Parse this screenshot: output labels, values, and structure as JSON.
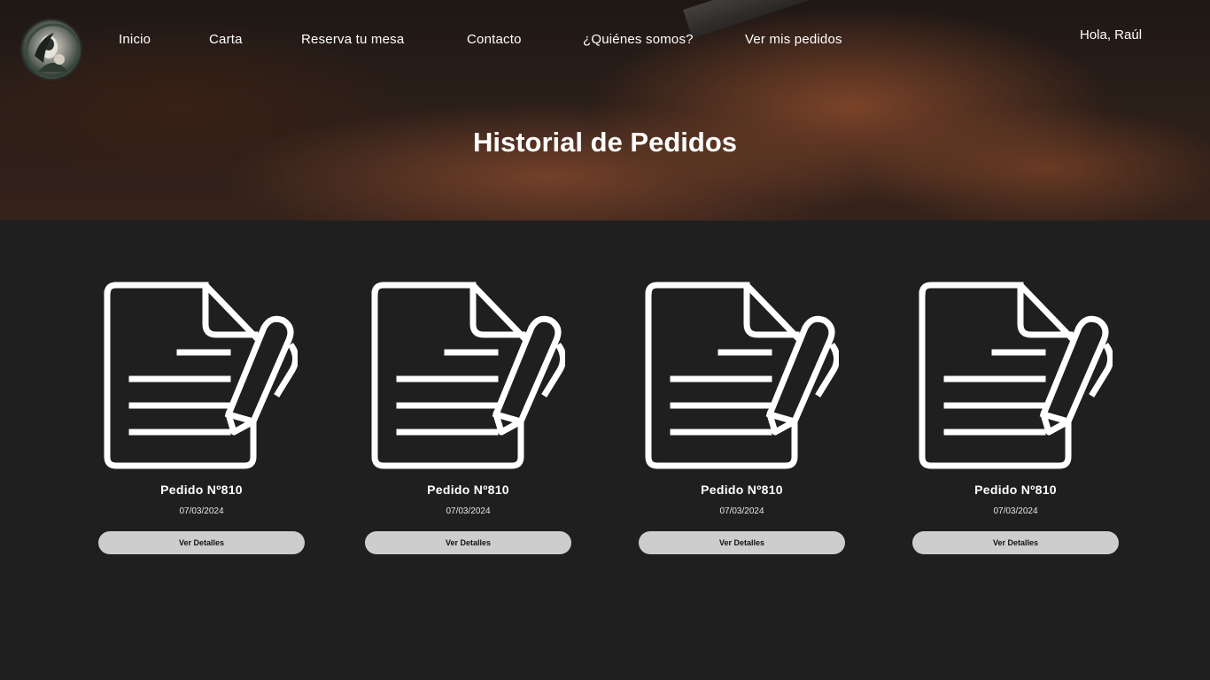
{
  "header": {
    "logo_alt": "restaurant-logo",
    "nav": [
      {
        "label": "Inicio"
      },
      {
        "label": "Carta"
      },
      {
        "label": "Reserva tu mesa"
      },
      {
        "label": "Contacto"
      },
      {
        "label": "¿Quiénes somos?"
      },
      {
        "label": "Ver mis pedidos"
      }
    ],
    "greeting": "Hola, Raúl"
  },
  "hero": {
    "title": "Historial de Pedidos"
  },
  "orders": [
    {
      "title": "Pedido Nº810",
      "date": "07/03/2024",
      "button_label": "Ver Detalles",
      "icon": "document-edit-icon"
    },
    {
      "title": "Pedido Nº810",
      "date": "07/03/2024",
      "button_label": "Ver Detalles",
      "icon": "document-edit-icon"
    },
    {
      "title": "Pedido Nº810",
      "date": "07/03/2024",
      "button_label": "Ver Detalles",
      "icon": "document-edit-icon"
    },
    {
      "title": "Pedido Nº810",
      "date": "07/03/2024",
      "button_label": "Ver Detalles",
      "icon": "document-edit-icon"
    }
  ],
  "colors": {
    "background": "#1f1f1f",
    "button": "#cdcdcd",
    "text": "#ffffff"
  }
}
